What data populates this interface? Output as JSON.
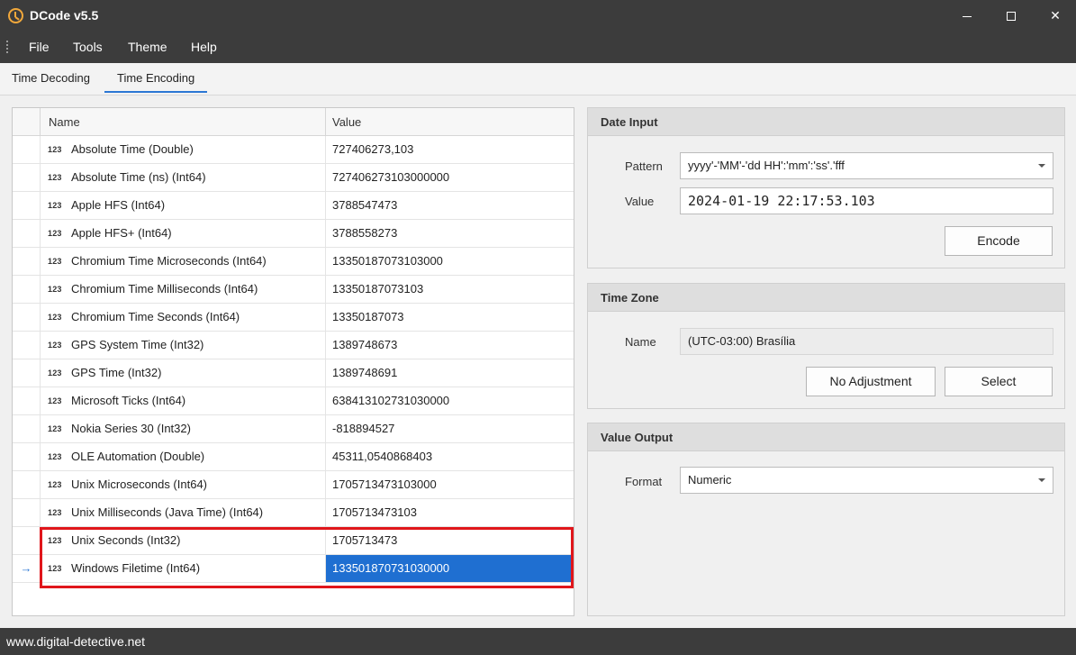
{
  "window": {
    "title": "DCode v5.5",
    "minimize_icon": "minimize-icon",
    "maximize_icon": "maximize-icon",
    "close_label": "✕"
  },
  "menu": {
    "items": [
      "File",
      "Tools",
      "Theme",
      "Help"
    ]
  },
  "tabs": [
    {
      "label": "Time Decoding",
      "active": false
    },
    {
      "label": "Time Encoding",
      "active": true
    }
  ],
  "grid": {
    "columns": {
      "name": "Name",
      "value": "Value"
    },
    "badge": "123",
    "current_row_indicator": "→",
    "rows": [
      {
        "name": "Absolute Time (Double)",
        "value": "727406273,103"
      },
      {
        "name": "Absolute Time (ns) (Int64)",
        "value": "727406273103000000"
      },
      {
        "name": "Apple HFS (Int64)",
        "value": "3788547473"
      },
      {
        "name": "Apple HFS+ (Int64)",
        "value": "3788558273"
      },
      {
        "name": "Chromium Time Microseconds (Int64)",
        "value": "13350187073103000"
      },
      {
        "name": "Chromium Time Milliseconds (Int64)",
        "value": "13350187073103"
      },
      {
        "name": "Chromium Time Seconds (Int64)",
        "value": "13350187073"
      },
      {
        "name": "GPS System Time (Int32)",
        "value": "1389748673"
      },
      {
        "name": "GPS Time (Int32)",
        "value": "1389748691"
      },
      {
        "name": "Microsoft Ticks (Int64)",
        "value": "638413102731030000"
      },
      {
        "name": "Nokia Series 30 (Int32)",
        "value": "-818894527"
      },
      {
        "name": "OLE Automation (Double)",
        "value": "45311,0540868403"
      },
      {
        "name": "Unix Microseconds (Int64)",
        "value": "1705713473103000"
      },
      {
        "name": "Unix Milliseconds (Java Time) (Int64)",
        "value": "1705713473103"
      },
      {
        "name": "Unix Seconds (Int32)",
        "value": "1705713473"
      },
      {
        "name": "Windows Filetime (Int64)",
        "value": "133501870731030000"
      }
    ]
  },
  "date_input": {
    "header": "Date Input",
    "pattern_label": "Pattern",
    "pattern_value": "yyyy'-'MM'-'dd HH':'mm':'ss'.'fff",
    "value_label": "Value",
    "value_value": "2024-01-19 22:17:53.103",
    "encode_button": "Encode"
  },
  "time_zone": {
    "header": "Time Zone",
    "name_label": "Name",
    "name_value": "(UTC-03:00) Brasília",
    "no_adjustment_button": "No Adjustment",
    "select_button": "Select"
  },
  "value_output": {
    "header": "Value Output",
    "format_label": "Format",
    "format_value": "Numeric"
  },
  "status": {
    "url": "www.digital-detective.net"
  },
  "colors": {
    "chrome": "#3c3c3c",
    "accent": "#2b77d4",
    "selection": "#1f6fd1",
    "highlight": "#e0161b",
    "app_icon": "#f2a83b"
  }
}
